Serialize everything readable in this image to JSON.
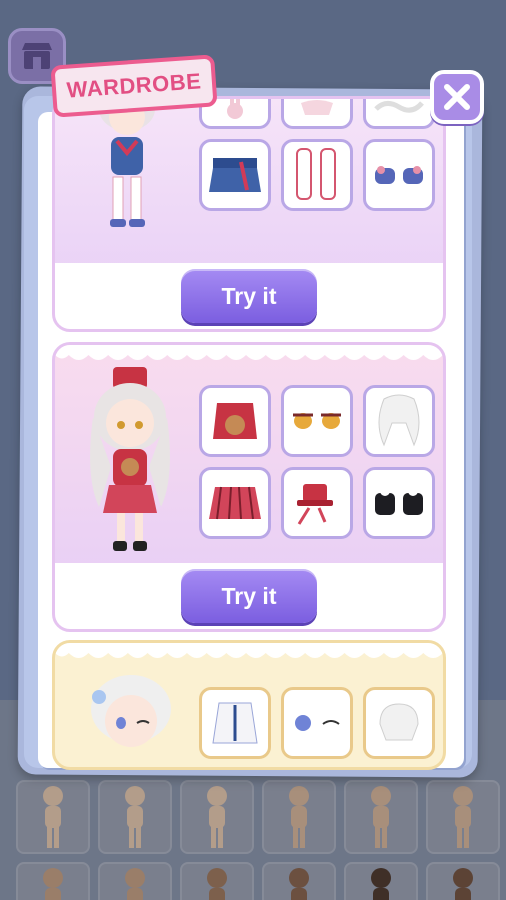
{
  "header": {
    "title": "WARDROBE",
    "close_icon": "close-icon"
  },
  "colors": {
    "accent_pink": "#e24f83",
    "button_purple": "#8b6ee8",
    "panel_border_lavender": "#b9a7e6",
    "panel_border_gold": "#e9c98a"
  },
  "outfits": [
    {
      "theme": "lavender",
      "try_label": "Try it",
      "items": [
        "bunny-accessory-icon",
        "skirt-icon",
        "wavy-hair-icon",
        "denim-skirt-icon",
        "white-stockings-icon",
        "blue-shoes-icon"
      ]
    },
    {
      "theme": "pink",
      "try_label": "Try it",
      "items": [
        "red-jacket-icon",
        "amber-eyes-icon",
        "white-wavy-hair-icon",
        "plaid-skirt-icon",
        "mini-top-hat-icon",
        "black-boots-icon"
      ]
    },
    {
      "theme": "yellow",
      "items": [
        "white-coat-icon",
        "blue-eyes-icon",
        "white-short-hair-icon"
      ]
    }
  ],
  "body_tiles": {
    "count": 12,
    "icon": "body-base-icon"
  }
}
